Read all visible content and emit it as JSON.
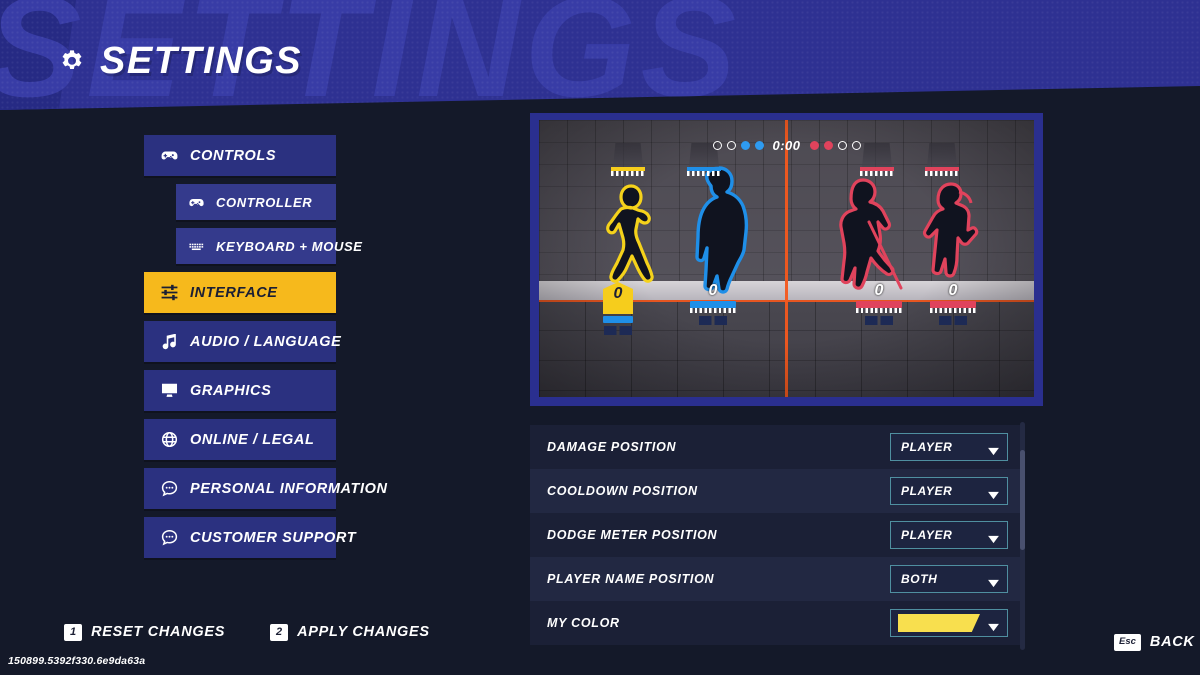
{
  "header": {
    "title": "SETTINGS",
    "ghost_text": "SETTINGS",
    "gear_icon": "gear-icon",
    "bg_color": "#2e3192"
  },
  "sidebar": {
    "items": [
      {
        "label": "CONTROLS",
        "icon": "gamepad-icon",
        "level": "top",
        "active": false
      },
      {
        "label": "CONTROLLER",
        "icon": "gamepad-icon",
        "level": "sub",
        "active": false
      },
      {
        "label": "KEYBOARD + MOUSE",
        "icon": "keyboard-icon",
        "level": "sub",
        "active": false
      },
      {
        "label": "INTERFACE",
        "icon": "sliders-icon",
        "level": "top",
        "active": true
      },
      {
        "label": "AUDIO / LANGUAGE",
        "icon": "music-note-icon",
        "level": "top",
        "active": false
      },
      {
        "label": "GRAPHICS",
        "icon": "monitor-icon",
        "level": "top",
        "active": false
      },
      {
        "label": "ONLINE / LEGAL",
        "icon": "globe-icon",
        "level": "top",
        "active": false
      },
      {
        "label": "PERSONAL INFORMATION",
        "icon": "chat-bubble-icon",
        "level": "top",
        "active": false
      },
      {
        "label": "CUSTOMER SUPPORT",
        "icon": "chat-bubble-icon",
        "level": "top",
        "active": false
      }
    ],
    "active_color": "#f6b91c",
    "item_color": "#2b3180"
  },
  "preview": {
    "timer": "0:00",
    "score_dots": [
      {
        "state": "empty",
        "team": "blue"
      },
      {
        "state": "empty",
        "team": "blue"
      },
      {
        "state": "filled",
        "team": "blue"
      },
      {
        "state": "filled",
        "team": "blue"
      },
      {
        "state": "filled",
        "team": "red"
      },
      {
        "state": "filled",
        "team": "red"
      },
      {
        "state": "empty",
        "team": "red"
      },
      {
        "state": "empty",
        "team": "red"
      }
    ],
    "players": [
      {
        "name": "player-1",
        "team_color": "#f6cd1c",
        "damage": "0",
        "is_self": true
      },
      {
        "name": "player-2",
        "team_color": "#1f8fe8",
        "damage": "0",
        "is_self": false
      },
      {
        "name": "player-3",
        "team_color": "#e0435c",
        "damage": "0",
        "is_self": false
      },
      {
        "name": "player-4",
        "team_color": "#e0435c",
        "damage": "0",
        "is_self": false
      }
    ],
    "frame_color": "#2a2f8f"
  },
  "settings_rows": [
    {
      "label": "DAMAGE POSITION",
      "value": "PLAYER",
      "type": "dropdown"
    },
    {
      "label": "COOLDOWN POSITION",
      "value": "PLAYER",
      "type": "dropdown"
    },
    {
      "label": "DODGE METER POSITION",
      "value": "PLAYER",
      "type": "dropdown"
    },
    {
      "label": "PLAYER NAME POSITION",
      "value": "BOTH",
      "type": "dropdown"
    },
    {
      "label": "MY COLOR",
      "value": "",
      "type": "color",
      "color": "#f8df4e"
    }
  ],
  "footer": {
    "reset": {
      "key": "1",
      "label": "RESET CHANGES"
    },
    "apply": {
      "key": "2",
      "label": "APPLY CHANGES"
    },
    "back": {
      "key": "Esc",
      "label": "BACK"
    },
    "version": "150899.5392f330.6e9da63a"
  }
}
